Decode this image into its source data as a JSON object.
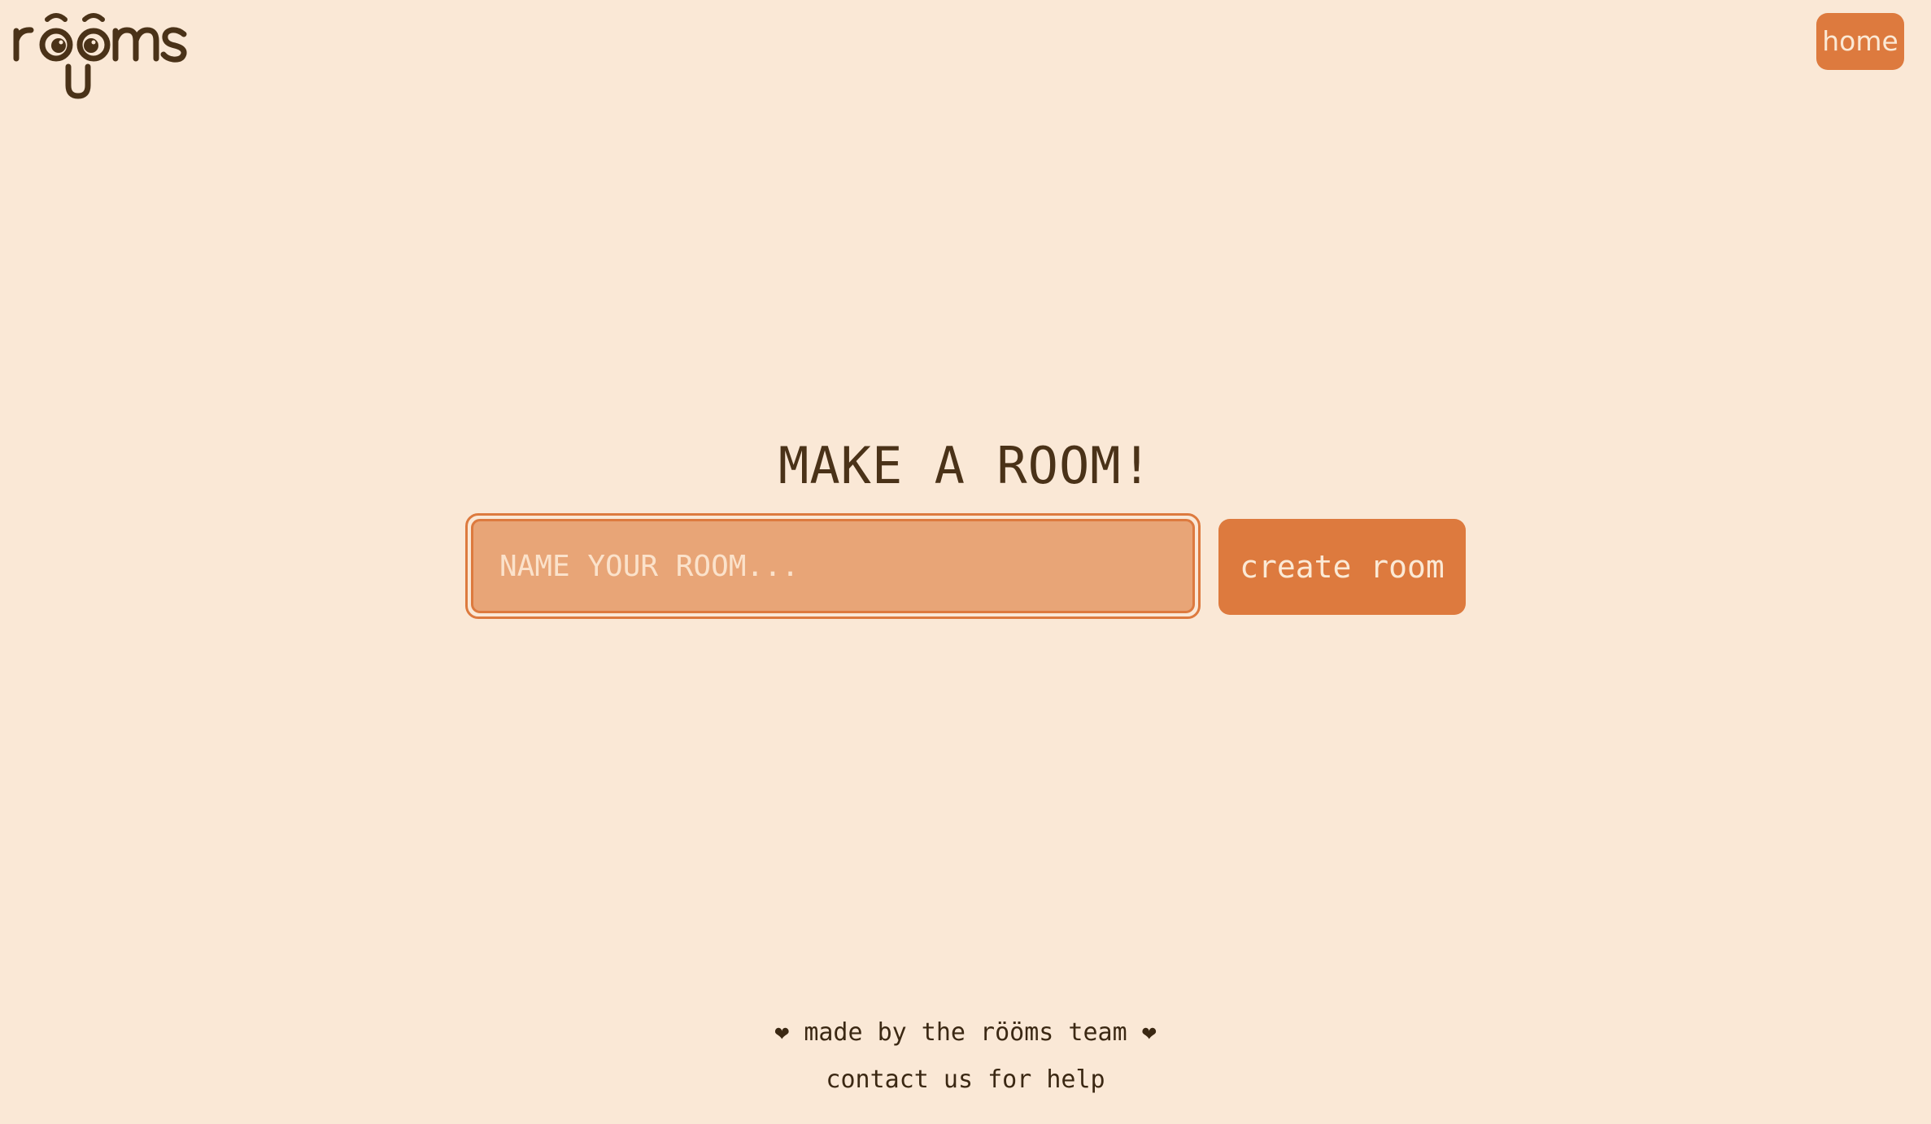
{
  "logo": {
    "text": "rööms",
    "icon": "rooms-logo-face"
  },
  "nav": {
    "home_label": "home"
  },
  "main": {
    "title": "MAKE A ROOM!",
    "input_placeholder": "NAME YOUR ROOM...",
    "input_value": "",
    "create_label": "create room"
  },
  "footer": {
    "heart_left": "❤",
    "made_by": "made by the rööms team",
    "heart_right": "❤",
    "contact_label": "contact us for help"
  },
  "colors": {
    "background": "#fae8d6",
    "accent": "#dd7a3e",
    "input_fill": "#e8a577",
    "text_dark": "#4a3218",
    "text_light": "#fbe9d5"
  }
}
